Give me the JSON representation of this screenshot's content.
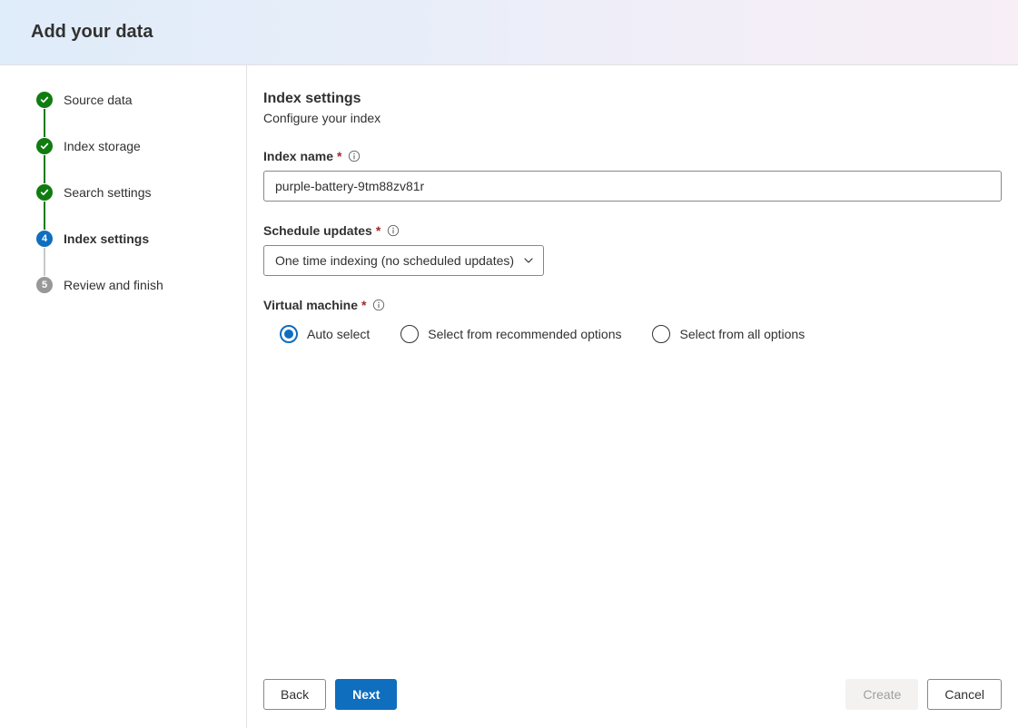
{
  "header": {
    "title": "Add your data"
  },
  "steps": [
    {
      "label": "Source data",
      "state": "done"
    },
    {
      "label": "Index storage",
      "state": "done"
    },
    {
      "label": "Search settings",
      "state": "done"
    },
    {
      "label": "Index settings",
      "state": "active",
      "number": "4"
    },
    {
      "label": "Review and finish",
      "state": "todo",
      "number": "5"
    }
  ],
  "section": {
    "title": "Index settings",
    "subtitle": "Configure your index"
  },
  "fields": {
    "index_name": {
      "label": "Index name",
      "value": "purple-battery-9tm88zv81r"
    },
    "schedule": {
      "label": "Schedule updates",
      "selected": "One time indexing (no scheduled updates)"
    },
    "vm": {
      "label": "Virtual machine",
      "options": {
        "auto": "Auto select",
        "recommended": "Select from recommended options",
        "all": "Select from all options"
      }
    }
  },
  "buttons": {
    "back": "Back",
    "next": "Next",
    "create": "Create",
    "cancel": "Cancel"
  }
}
